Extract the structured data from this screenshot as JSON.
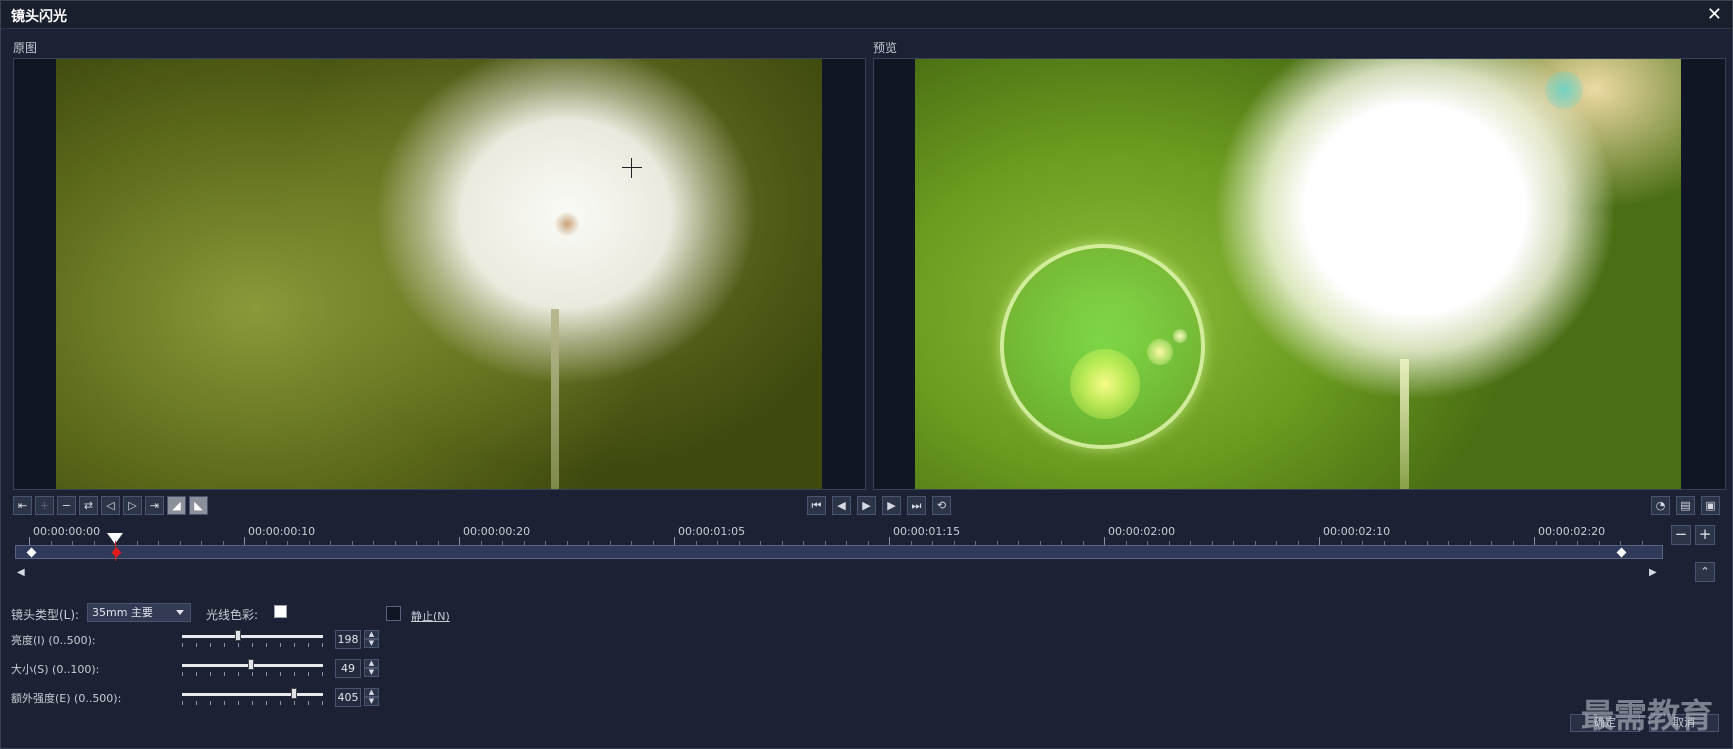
{
  "window": {
    "title": "镜头闪光",
    "close_icon": "✕"
  },
  "panels": {
    "original_label": "原图",
    "preview_label": "预览"
  },
  "toolbar_left": [
    {
      "name": "go-to-keyframe-left-button",
      "glyph": "⇤",
      "disabled": false
    },
    {
      "name": "add-keyframe-button",
      "glyph": "+",
      "disabled": true
    },
    {
      "name": "remove-keyframe-button",
      "glyph": "−",
      "disabled": false
    },
    {
      "name": "reverse-keyframes-button",
      "glyph": "⇄",
      "disabled": false
    },
    {
      "name": "prev-keyframe-button",
      "glyph": "◁",
      "disabled": false
    },
    {
      "name": "next-keyframe-button",
      "glyph": "▷",
      "disabled": false
    },
    {
      "name": "go-to-keyframe-right-button",
      "glyph": "⇥",
      "disabled": false
    },
    {
      "name": "fade-in-button",
      "glyph": "◢",
      "disabled": false,
      "light": true
    },
    {
      "name": "fade-out-button",
      "glyph": "◣",
      "disabled": false,
      "light": true
    }
  ],
  "playback": [
    {
      "name": "home-button",
      "glyph": "⏮"
    },
    {
      "name": "prev-frame-button",
      "glyph": "◀"
    },
    {
      "name": "play-button",
      "glyph": "▶"
    },
    {
      "name": "next-frame-button",
      "glyph": "▶"
    },
    {
      "name": "end-button",
      "glyph": "⏭"
    },
    {
      "name": "repeat-button",
      "glyph": "⟲"
    }
  ],
  "toolbar_right": [
    {
      "name": "speed-icon-button",
      "glyph": "◔"
    },
    {
      "name": "preview-device-button",
      "glyph": "▤"
    },
    {
      "name": "preview-toggle-button",
      "glyph": "▣"
    }
  ],
  "timeline": {
    "ticks": [
      "00:00:00:00",
      "00:00:00:10",
      "00:00:00:20",
      "00:00:01:05",
      "00:00:01:15",
      "00:00:02:00",
      "00:00:02:10",
      "00:00:02:20"
    ],
    "zoom_out": "−",
    "zoom_in": "+",
    "collapse": "⌃",
    "scroll_left": "◀",
    "scroll_right": "▶"
  },
  "form": {
    "lens_type_label": "镜头类型(L):",
    "lens_type_value": "35mm 主要",
    "ray_color_label": "光线色彩:",
    "ray_color": "#ffffff",
    "static_label": "静止(N)",
    "sliders": [
      {
        "label": "亮度(I) (0..500):",
        "value": "198",
        "fraction": 0.396
      },
      {
        "label": "大小(S) (0..100):",
        "value": "49",
        "fraction": 0.49
      },
      {
        "label": "额外强度(E) (0..500):",
        "value": "405",
        "fraction": 0.81
      }
    ]
  },
  "buttons": {
    "ok": "确定",
    "cancel": "取消"
  },
  "watermark": "最需教育",
  "colors": {
    "background": "#1c2233",
    "keyframe_active": "#e21c1c"
  }
}
